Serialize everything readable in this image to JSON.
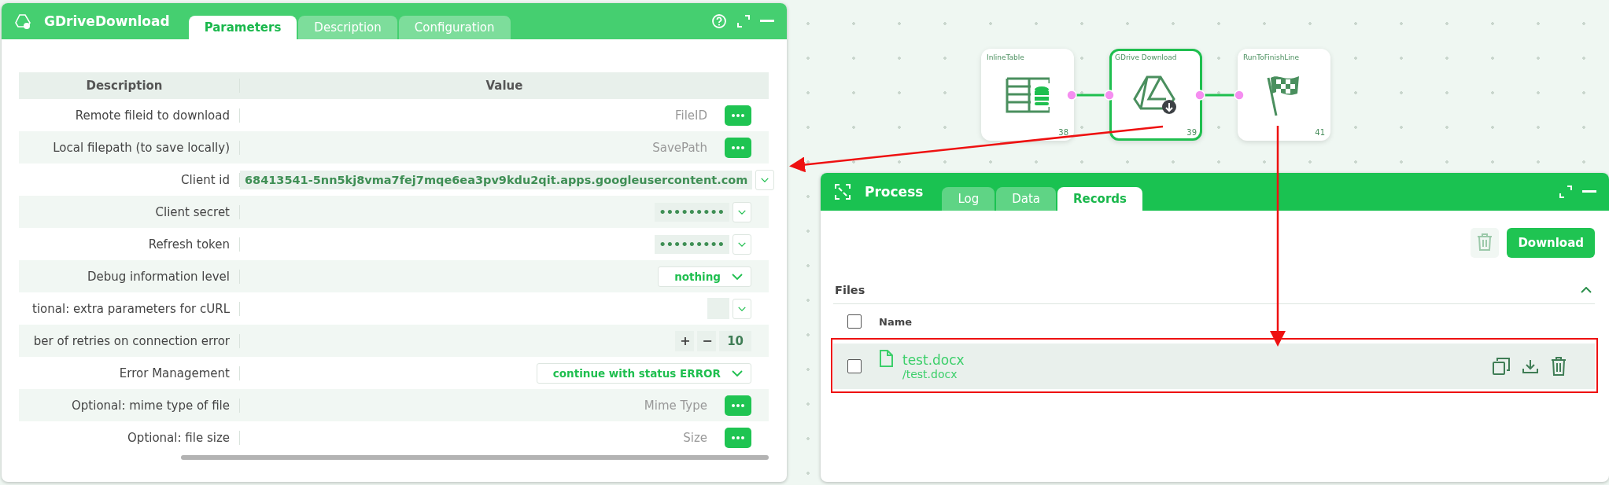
{
  "params_window": {
    "title": "GDriveDownload",
    "tabs": [
      {
        "label": "Parameters",
        "selected": true
      },
      {
        "label": "Description",
        "selected": false
      },
      {
        "label": "Configuration",
        "selected": false
      }
    ],
    "table": {
      "columns": [
        "Description",
        "Value"
      ],
      "rows": [
        {
          "label": "Remote fileid to download",
          "kind": "text",
          "placeholder": "FileID"
        },
        {
          "label": "Local filepath (to save locally)",
          "kind": "text",
          "placeholder": "SavePath"
        },
        {
          "label": "Client id",
          "kind": "combo",
          "value": "68413541-5nn5kj8vma7fej7mqe6ea3pv9kdu2qit.apps.googleusercontent.com"
        },
        {
          "label": "Client secret",
          "kind": "combo",
          "value": "•••••••••"
        },
        {
          "label": "Refresh token",
          "kind": "combo",
          "value": "•••••••••"
        },
        {
          "label": "Debug information level",
          "kind": "select",
          "value": "nothing"
        },
        {
          "label": "tional: extra parameters for cURL",
          "kind": "combo"
        },
        {
          "label": "ber of retries on connection error",
          "kind": "stepper",
          "plus": "+",
          "minus": "−",
          "value": "10"
        },
        {
          "label": "Error Management",
          "kind": "select",
          "value": "continue with status ERROR"
        },
        {
          "label": "Optional: mime type of file",
          "kind": "text",
          "placeholder": "Mime Type"
        },
        {
          "label": "Optional: file size",
          "kind": "text",
          "placeholder": "Size"
        }
      ]
    }
  },
  "flow": {
    "nodes": [
      {
        "title": "InlineTable",
        "number": "38",
        "selected": false,
        "kind": "table"
      },
      {
        "title": "GDrive Download",
        "number": "39",
        "selected": true,
        "kind": "drive"
      },
      {
        "title": "RunToFinishLine",
        "number": "41",
        "selected": false,
        "kind": "flag"
      }
    ]
  },
  "process_window": {
    "title": "Process",
    "tabs": [
      {
        "label": "Log",
        "selected": false
      },
      {
        "label": "Data",
        "selected": false
      },
      {
        "label": "Records",
        "selected": true
      }
    ],
    "download_button": "Download",
    "files": {
      "title": "Files",
      "expanded": true,
      "column": "Name",
      "all_checked": false,
      "rows": [
        {
          "name": "test.docx",
          "path": "/test.docx",
          "checked": false,
          "selected": true
        }
      ]
    }
  }
}
